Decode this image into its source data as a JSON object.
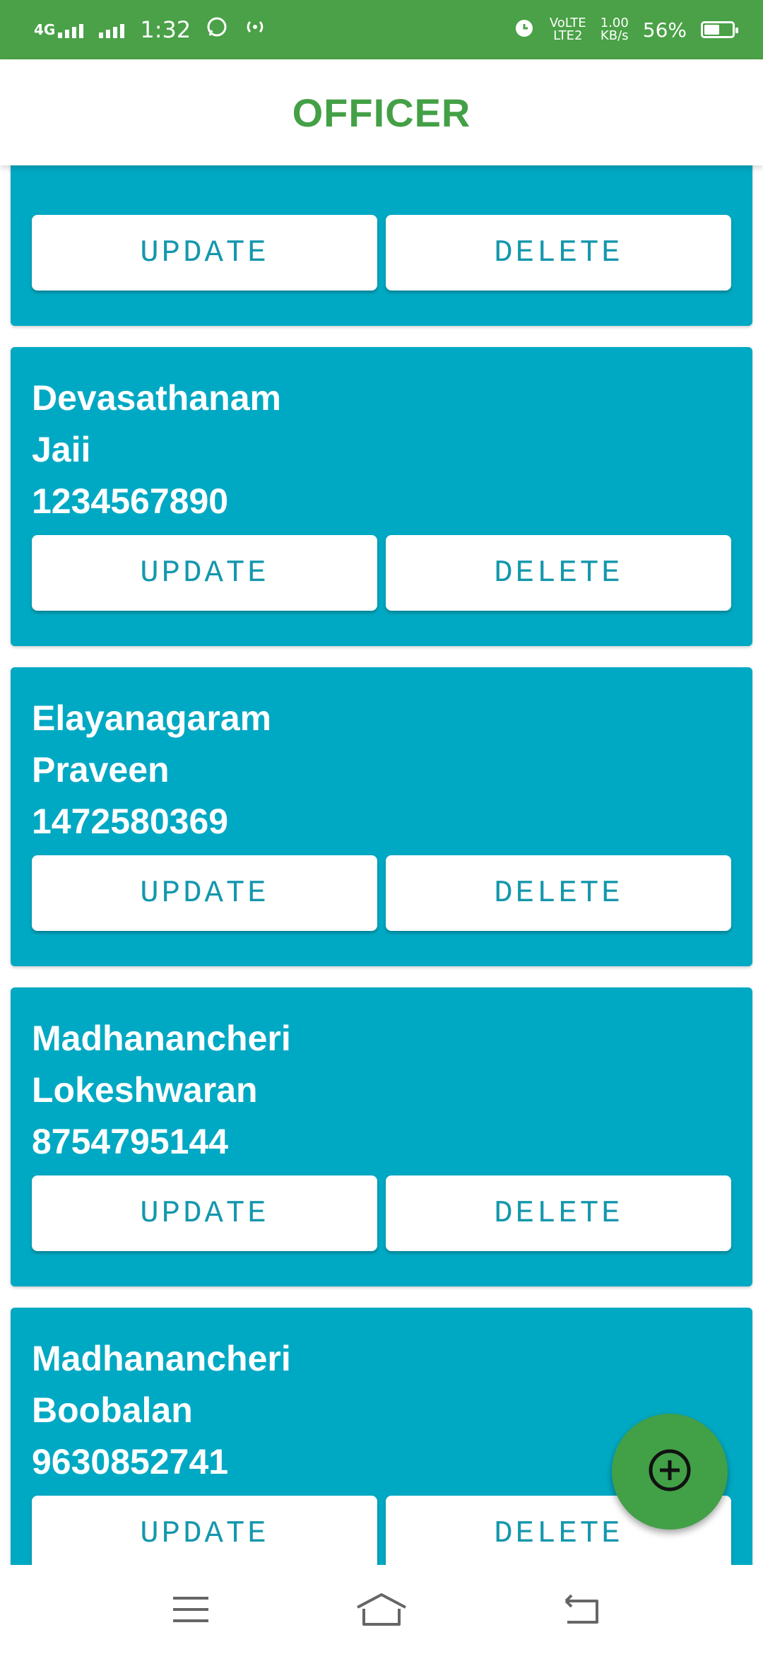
{
  "status_bar": {
    "network": "4G",
    "time": "1:32",
    "volte": "VoLTE",
    "lte": "LTE2",
    "speed": "1.00",
    "speed_unit": "KB/s",
    "battery": "56%",
    "battery_level": 0.56
  },
  "app_bar": {
    "title": "OFFICER"
  },
  "officers": [
    {
      "place": "",
      "name": "",
      "phone": "",
      "update_label": "UPDATE",
      "delete_label": "DELETE"
    },
    {
      "place": "Devasathanam",
      "name": "Jaii",
      "phone": "1234567890",
      "update_label": "UPDATE",
      "delete_label": "DELETE"
    },
    {
      "place": "Elayanagaram",
      "name": "Praveen",
      "phone": "1472580369",
      "update_label": "UPDATE",
      "delete_label": "DELETE"
    },
    {
      "place": "Madhanancheri",
      "name": "Lokeshwaran",
      "phone": "8754795144",
      "update_label": "UPDATE",
      "delete_label": "DELETE"
    },
    {
      "place": "Madhanancheri",
      "name": "Boobalan",
      "phone": "9630852741",
      "update_label": "UPDATE",
      "delete_label": "DELETE"
    }
  ],
  "icons": {
    "fab": "add-circle-icon",
    "nav_menu": "menu-icon",
    "nav_home": "home-icon",
    "nav_back": "back-icon",
    "whatsapp": "whatsapp-icon",
    "hotspot": "hotspot-icon",
    "alarm": "alarm-icon"
  },
  "colors": {
    "status_bar": "#4aa147",
    "title": "#44a046",
    "card": "#00a9c3",
    "button_text": "#1597ad",
    "fab": "#42a047"
  }
}
